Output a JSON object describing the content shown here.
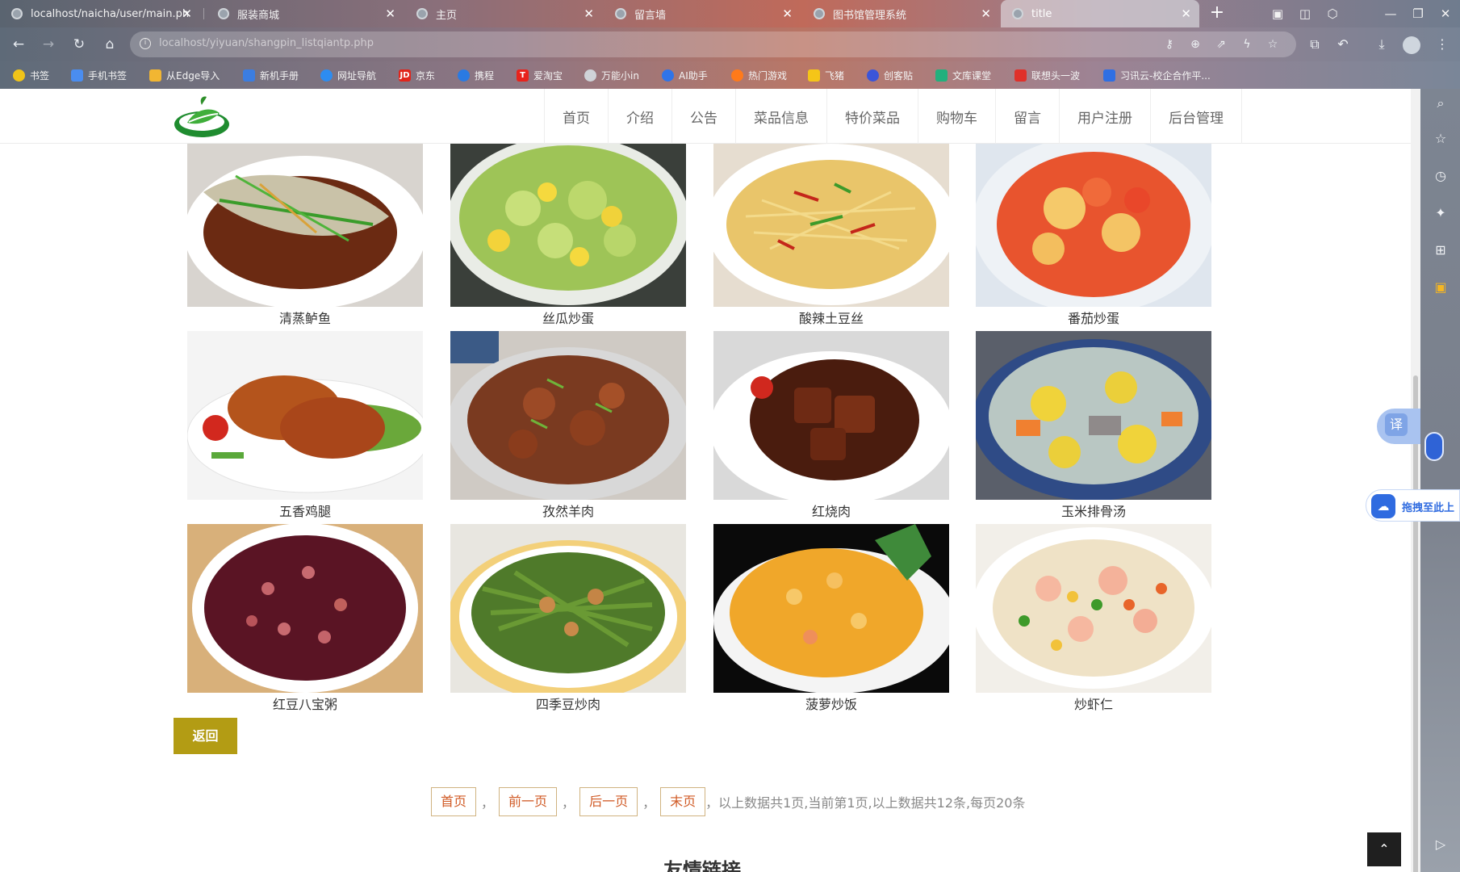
{
  "browser": {
    "tabs": [
      {
        "title": "localhost/naicha/user/main.ph"
      },
      {
        "title": "服装商城"
      },
      {
        "title": "主页"
      },
      {
        "title": "留言墙"
      },
      {
        "title": "图书馆管理系统"
      },
      {
        "title": "title"
      }
    ],
    "url": "localhost/yiyuan/shangpin_listqiantp.php",
    "bookmarks": [
      {
        "label": "书签",
        "color": "#f0c419"
      },
      {
        "label": "手机书签",
        "color": "#4a8df0"
      },
      {
        "label": "从Edge导入",
        "color": "#f2b632"
      },
      {
        "label": "新机手册",
        "color": "#3b7de0"
      },
      {
        "label": "网址导航",
        "color": "#2d8cf0"
      },
      {
        "label": "京东",
        "color": "#e1251b"
      },
      {
        "label": "携程",
        "color": "#2a7ae2"
      },
      {
        "label": "爱淘宝",
        "color": "#e8231c"
      },
      {
        "label": "万能小in",
        "color": "#cfd3d8"
      },
      {
        "label": "AI助手",
        "color": "#2f74e8"
      },
      {
        "label": "热门游戏",
        "color": "#ff7a1a"
      },
      {
        "label": "飞猪",
        "color": "#f5c518"
      },
      {
        "label": "创客贴",
        "color": "#3b55d9"
      },
      {
        "label": "文库课堂",
        "color": "#22b07d"
      },
      {
        "label": "联想头一波",
        "color": "#e0302a"
      },
      {
        "label": "习讯云-校企合作平...",
        "color": "#2f6fe3"
      }
    ]
  },
  "site": {
    "nav": [
      "首页",
      "介绍",
      "公告",
      "菜品信息",
      "特价菜品",
      "购物车",
      "留言",
      "用户注册",
      "后台管理"
    ]
  },
  "products": [
    {
      "name": "清蒸鲈鱼"
    },
    {
      "name": "丝瓜炒蛋"
    },
    {
      "name": "酸辣土豆丝"
    },
    {
      "name": "番茄炒蛋"
    },
    {
      "name": "五香鸡腿"
    },
    {
      "name": "孜然羊肉"
    },
    {
      "name": "红烧肉"
    },
    {
      "name": "玉米排骨汤"
    },
    {
      "name": "红豆八宝粥"
    },
    {
      "name": "四季豆炒肉"
    },
    {
      "name": "菠萝炒饭"
    },
    {
      "name": "炒虾仁"
    }
  ],
  "back_label": "返回",
  "pager": {
    "first": "首页",
    "prev": "前一页",
    "next": "后一页",
    "last": "末页",
    "sep": "，",
    "summary": "，以上数据共1页,当前第1页,以上数据共12条,每页20条"
  },
  "friend_links_title": "友情链接",
  "widgets": {
    "translate": "译",
    "upload_text": "拖拽至此上"
  }
}
